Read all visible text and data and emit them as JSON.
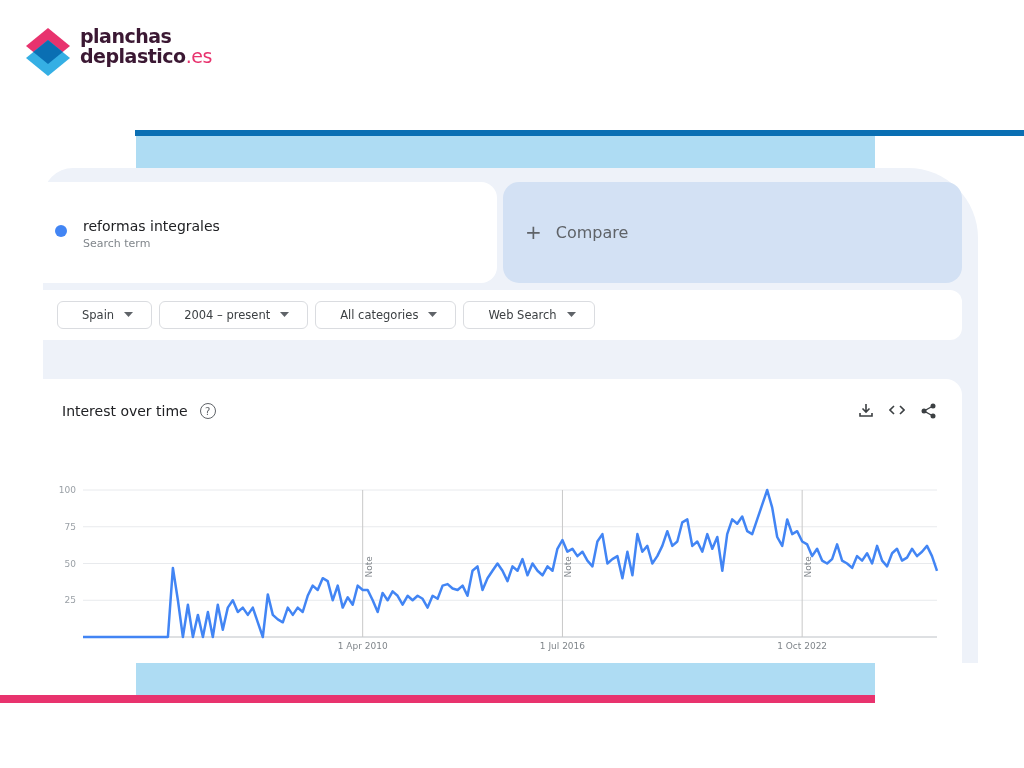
{
  "logo": {
    "line1": "planchas",
    "line2": "deplastico",
    "suffix": ".es"
  },
  "search_term": {
    "color": "#4285f4",
    "term": "reformas integrales",
    "caption": "Search term"
  },
  "compare": {
    "icon": "+",
    "label": "Compare"
  },
  "filters": [
    "Spain",
    "2004 – present",
    "All categories",
    "Web Search"
  ],
  "interest": {
    "title": "Interest over time",
    "help": "?",
    "notes": [
      "Note",
      "Note",
      "Note"
    ],
    "chart_data": {
      "type": "line",
      "grid": true,
      "ylim": [
        0,
        100
      ],
      "yticks": [
        25,
        50,
        75,
        100
      ],
      "categories": [
        null,
        null,
        null,
        null,
        null,
        null,
        null,
        null,
        null,
        null,
        null,
        null,
        null,
        null,
        null,
        null,
        null,
        null,
        null,
        null,
        null,
        null,
        null,
        null,
        null,
        null,
        null,
        null,
        null,
        null,
        null,
        null,
        null,
        null,
        null,
        null,
        null,
        null,
        null,
        null,
        null,
        null,
        null,
        null,
        null,
        null,
        null,
        null,
        null,
        null,
        null,
        null,
        null,
        null,
        null,
        null,
        "1 Apr 2010",
        null,
        null,
        null,
        null,
        null,
        null,
        null,
        null,
        null,
        null,
        null,
        null,
        null,
        null,
        null,
        null,
        null,
        null,
        null,
        null,
        null,
        null,
        null,
        null,
        null,
        null,
        null,
        null,
        null,
        null,
        null,
        null,
        null,
        null,
        null,
        null,
        null,
        null,
        null,
        "1 Jul 2016",
        null,
        null,
        null,
        null,
        null,
        null,
        null,
        null,
        null,
        null,
        null,
        null,
        null,
        null,
        null,
        null,
        null,
        null,
        null,
        null,
        null,
        null,
        null,
        null,
        null,
        null,
        null,
        null,
        null,
        null,
        null,
        null,
        null,
        null,
        null,
        null,
        null,
        null,
        null,
        null,
        null,
        null,
        null,
        null,
        null,
        null,
        null,
        "1 Oct 2022",
        null,
        null,
        null,
        null,
        null,
        null,
        null,
        null,
        null,
        null,
        null,
        null,
        null,
        null,
        null,
        null,
        null,
        null,
        null,
        null,
        null,
        null,
        null,
        null,
        null,
        null,
        null
      ],
      "series": [
        {
          "color": "#4285f4",
          "values": [
            0,
            0,
            0,
            0,
            0,
            0,
            0,
            0,
            0,
            0,
            0,
            0,
            0,
            0,
            0,
            0,
            0,
            0,
            47,
            25,
            0,
            22,
            0,
            15,
            0,
            17,
            0,
            22,
            5,
            20,
            25,
            17,
            20,
            15,
            20,
            10,
            0,
            29,
            15,
            12,
            10,
            20,
            15,
            20,
            17,
            28,
            35,
            32,
            40,
            38,
            25,
            35,
            20,
            27,
            22,
            35,
            32,
            32,
            25,
            17,
            30,
            25,
            31,
            28,
            22,
            28,
            25,
            28,
            26,
            20,
            28,
            26,
            35,
            36,
            33,
            32,
            35,
            28,
            45,
            48,
            32,
            40,
            45,
            50,
            45,
            38,
            48,
            45,
            53,
            42,
            50,
            45,
            42,
            48,
            45,
            60,
            66,
            58,
            60,
            55,
            58,
            52,
            48,
            65,
            70,
            50,
            53,
            55,
            40,
            58,
            42,
            70,
            58,
            62,
            50,
            55,
            62,
            72,
            62,
            65,
            78,
            80,
            62,
            65,
            58,
            70,
            60,
            68,
            45,
            70,
            80,
            77,
            82,
            72,
            70,
            80,
            90,
            100,
            88,
            68,
            62,
            80,
            70,
            72,
            65,
            63,
            55,
            60,
            52,
            50,
            53,
            63,
            52,
            50,
            47,
            55,
            52,
            57,
            50,
            62,
            52,
            48,
            57,
            60,
            52,
            54,
            60,
            55,
            58,
            62,
            55,
            45
          ]
        }
      ]
    }
  }
}
